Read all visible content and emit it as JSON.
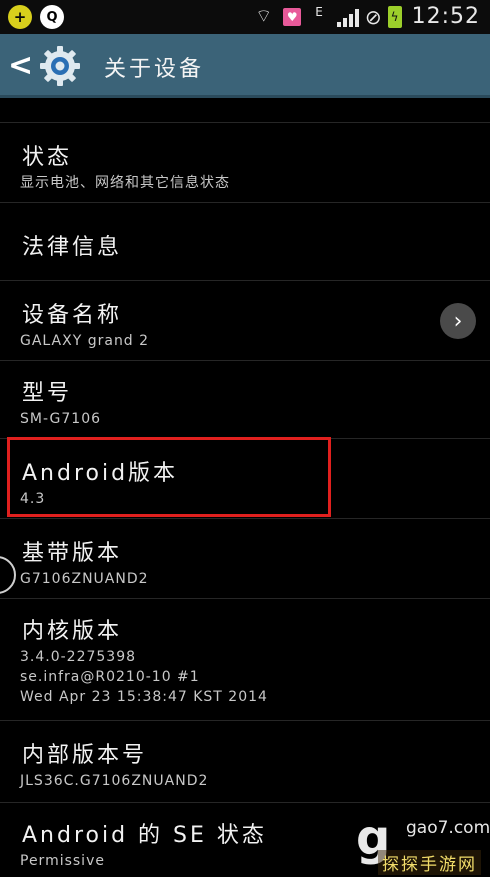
{
  "status_bar": {
    "plus_icon": "+",
    "qq_icon": "Q",
    "network_type": "E",
    "time": "12:52"
  },
  "header": {
    "back_icon": "<",
    "title": "关于设备"
  },
  "items": [
    {
      "title": "状态",
      "subtitle": "显示电池、网络和其它信息状态"
    },
    {
      "title": "法律信息",
      "subtitle": ""
    },
    {
      "title": "设备名称",
      "subtitle": "GALAXY grand 2"
    },
    {
      "title": "型号",
      "subtitle": "SM-G7106"
    },
    {
      "title": "Android版本",
      "subtitle": "4.3"
    },
    {
      "title": "基带版本",
      "subtitle": "G7106ZNUAND2"
    },
    {
      "title": "内核版本",
      "subtitle": "3.4.0-2275398\nse.infra@R0210-10 #1\nWed Apr 23 15:38:47 KST 2014"
    },
    {
      "title": "内部版本号",
      "subtitle": "JLS36C.G7106ZNUAND2"
    },
    {
      "title": "Android 的 SE 状态",
      "subtitle": "Permissive"
    }
  ],
  "watermark": {
    "logo_letter": "g",
    "site": "gao7.com",
    "tag": "探探手游网"
  },
  "colors": {
    "title_bar": "#3b6378",
    "highlight_border": "#e0201e",
    "battery": "#9ccf2b"
  }
}
